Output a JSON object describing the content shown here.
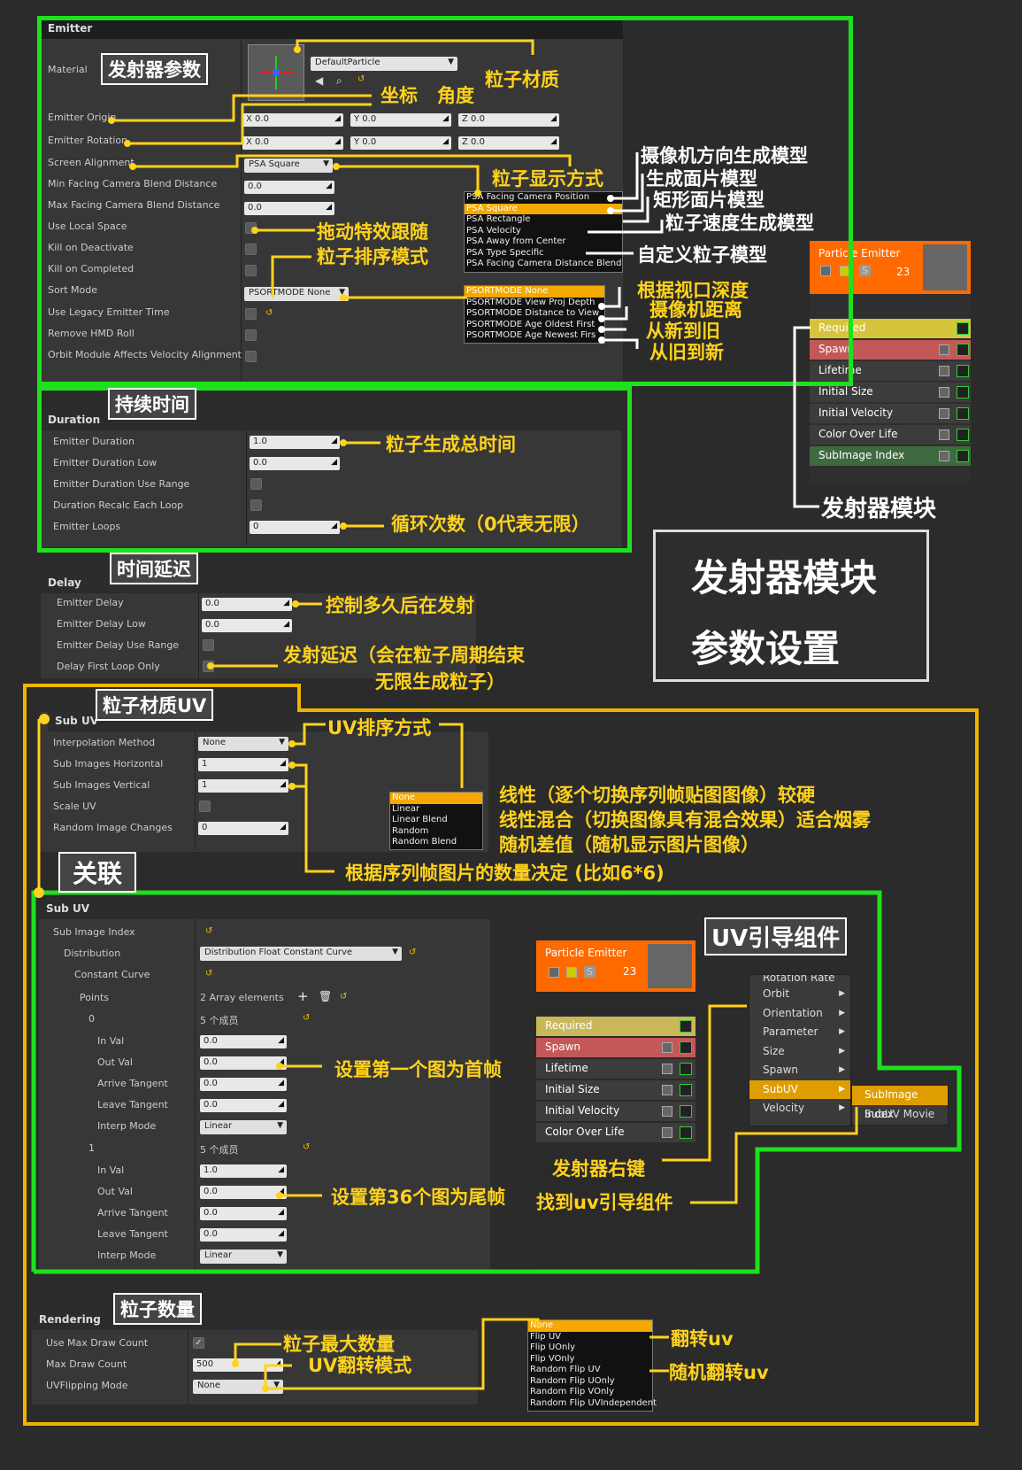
{
  "emitter": {
    "header": "Emitter",
    "material_label": "Material",
    "material_value": "DefaultParticle",
    "rows": [
      "Emitter Origin",
      "Emitter Rotation",
      "Screen Alignment",
      "Min Facing Camera Blend Distance",
      "Max Facing Camera Blend Distance",
      "Use Local Space",
      "Kill on Deactivate",
      "Kill on Completed",
      "Sort Mode",
      "Use Legacy Emitter Time",
      "Remove HMD Roll",
      "Orbit Module Affects Velocity Alignment"
    ],
    "origin": {
      "x": "X 0.0",
      "y": "Y 0.0",
      "z": "Z 0.0"
    },
    "rotation": {
      "x": "X 0.0",
      "y": "Y 0.0",
      "z": "Z 0.0"
    },
    "screen_alignment": "PSA Square",
    "min_blend": "0.0",
    "max_blend": "0.0",
    "sort_mode": "PSORTMODE None",
    "alignment_options": [
      "PSA Facing Camera Position",
      "PSA Square",
      "PSA Rectangle",
      "PSA Velocity",
      "PSA Away from Center",
      "PSA Type Specific",
      "PSA Facing Camera Distance Blend"
    ],
    "sort_options": [
      "PSORTMODE None",
      "PSORTMODE View Proj Depth",
      "PSORTMODE Distance to View",
      "PSORTMODE Age Oldest First",
      "PSORTMODE Age Newest Firs"
    ]
  },
  "duration": {
    "header": "Duration",
    "rows": [
      "Emitter Duration",
      "Emitter Duration Low",
      "Emitter Duration Use Range",
      "Duration Recalc Each Loop",
      "Emitter Loops"
    ],
    "values": [
      "1.0",
      "0.0",
      "0"
    ]
  },
  "delay": {
    "header": "Delay",
    "rows": [
      "Emitter Delay",
      "Emitter Delay Low",
      "Emitter Delay Use Range",
      "Delay First Loop Only"
    ],
    "values": [
      "0.0",
      "0.0"
    ]
  },
  "subuv": {
    "header": "Sub UV",
    "rows": [
      "Interpolation Method",
      "Sub Images Horizontal",
      "Sub Images Vertical",
      "Scale UV",
      "Random Image Changes"
    ],
    "interp": "None",
    "h": "1",
    "v": "1",
    "random": "0",
    "interp_options": [
      "None",
      "Linear",
      "Linear Blend",
      "Random",
      "Random Blend"
    ]
  },
  "subuv2": {
    "header": "Sub UV",
    "sub_image_index": "Sub Image Index",
    "distribution": "Distribution",
    "distribution_value": "Distribution Float Constant Curve",
    "constant_curve": "Constant Curve",
    "points": "Points",
    "points_value": "2 Array elements",
    "p0": "0",
    "p1": "1",
    "members": "5 个成员",
    "fields": [
      "In Val",
      "Out Val",
      "Arrive Tangent",
      "Leave Tangent",
      "Interp Mode"
    ],
    "p0_vals": [
      "0.0",
      "0.0",
      "0.0",
      "0.0"
    ],
    "p1_vals": [
      "1.0",
      "0.0",
      "0.0",
      "0.0"
    ],
    "interp_mode": "Linear"
  },
  "rendering": {
    "header": "Rendering",
    "rows": [
      "Use Max Draw Count",
      "Max Draw Count",
      "UVFlipping Mode"
    ],
    "max_draw": "500",
    "uvflip": "None",
    "flip_options": [
      "None",
      "Flip UV",
      "Flip UOnly",
      "Flip VOnly",
      "Random Flip UV",
      "Random Flip UOnly",
      "Random Flip VOnly",
      "Random Flip UVIndependent"
    ]
  },
  "particle_emitter": {
    "title": "Particle Emitter",
    "count": "23",
    "s": "S",
    "modules": [
      "Required",
      "Spawn",
      "Lifetime",
      "Initial Size",
      "Initial Velocity",
      "Color Over Life",
      "SubImage Index"
    ],
    "modules2": [
      "Required",
      "Spawn",
      "Lifetime",
      "Initial Size",
      "Initial Velocity",
      "Color Over Life"
    ]
  },
  "context_menu": {
    "items": [
      "Rotation Rate",
      "Orbit",
      "Orientation",
      "Parameter",
      "Size",
      "Spawn",
      "SubUV",
      "Velocity"
    ],
    "sub": [
      "SubImage Index",
      "SubUV Movie"
    ]
  },
  "annotations": {
    "emitter_params": "发射器参数",
    "material": "粒子材质",
    "coord": "坐标",
    "angle": "角度",
    "display": "粒子显示方式",
    "cam_dir": "摄像机方向生成模型",
    "plane": "生成面片模型",
    "rect": "矩形面片模型",
    "vel": "粒子速度生成模型",
    "custom": "自定义粒子模型",
    "local": "拖动特效跟随",
    "sort": "粒子排序模式",
    "depth": "根据视口深度",
    "camdist": "摄像机距离",
    "newold": "从新到旧",
    "oldnew": "从旧到新",
    "module": "发射器模块",
    "dur_tag": "持续时间",
    "dur_total": "粒子生成总时间",
    "loops": "循环次数（0代表无限）",
    "delay_tag": "时间延迟",
    "delay_ctrl": "控制多久后在发射",
    "delay_first": "发射延迟（会在粒子周期结束",
    "delay_first2": "无限生成粒子）",
    "big1": "发射器模块",
    "big2": "参数设置",
    "uv_tag": "粒子材质UV",
    "uv_sort": "UV排序方式",
    "linear": "线性（逐个切换序列帧贴图图像）较硬",
    "blend": "线性混合（切换图像具有混合效果）适合烟雾",
    "random": "随机差值（随机显示图片图像）",
    "count_by": "根据序列帧图片的数量决定 (比如6*6)",
    "link": "关联",
    "uv_comp": "UV引导组件",
    "first": "设置第一个图为首帧",
    "last": "设置第36个图为尾帧",
    "rclick": "发射器右键",
    "find": "找到uv引导组件",
    "num_tag": "粒子数量",
    "max": "粒子最大数量",
    "flipmode": "UV翻转模式",
    "flipuv": "翻转uv",
    "randflip": "随机翻转uv"
  }
}
